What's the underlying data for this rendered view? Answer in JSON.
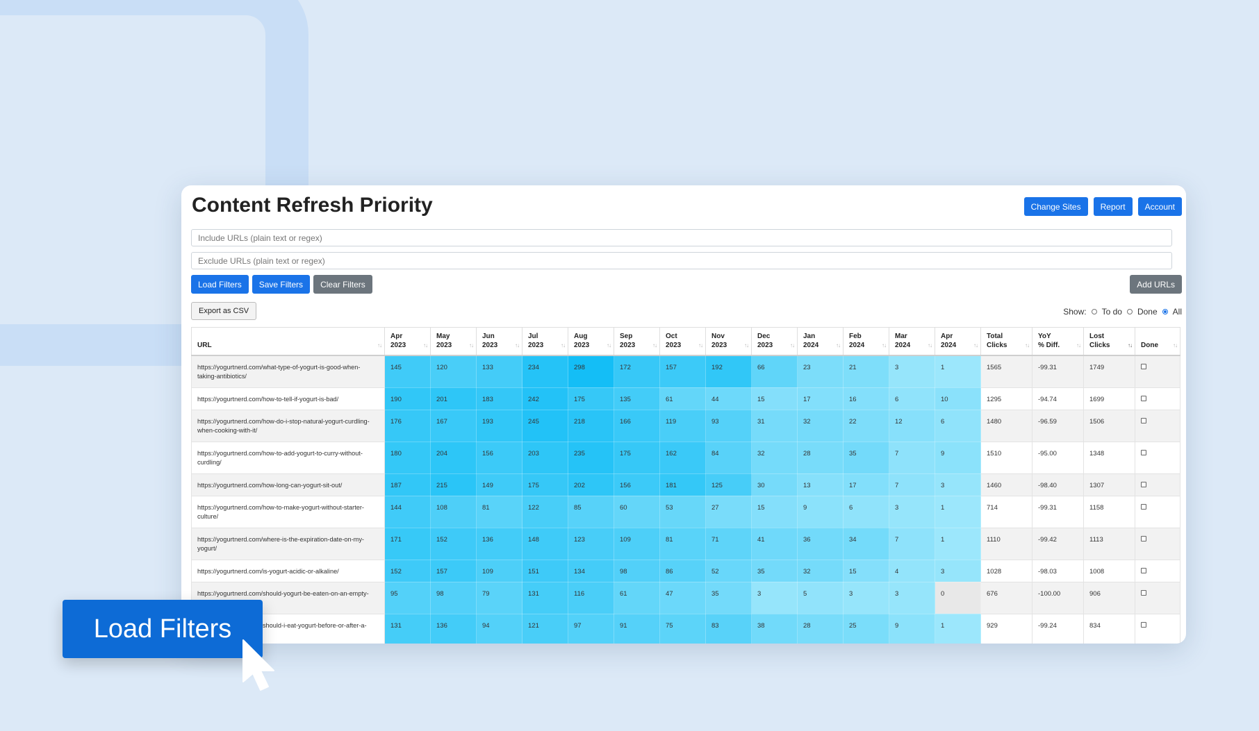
{
  "title": "Content Refresh Priority",
  "top_buttons": {
    "change_sites": "Change Sites",
    "report": "Report",
    "account": "Account"
  },
  "include_placeholder": "Include URLs (plain text or regex)",
  "exclude_placeholder": "Exclude URLs (plain text or regex)",
  "filter_buttons": {
    "load": "Load Filters",
    "save": "Save Filters",
    "clear": "Clear Filters"
  },
  "add_urls": "Add URLs",
  "export_csv": "Export as CSV",
  "show": {
    "label": "Show:",
    "todo": "To do",
    "done": "Done",
    "all": "All",
    "selected": "All"
  },
  "columns": [
    "URL",
    "Apr 2023",
    "May 2023",
    "Jun 2023",
    "Jul 2023",
    "Aug 2023",
    "Sep 2023",
    "Oct 2023",
    "Nov 2023",
    "Dec 2023",
    "Jan 2024",
    "Feb 2024",
    "Mar 2024",
    "Apr 2024",
    "Total Clicks",
    "YoY % Diff.",
    "Lost Clicks",
    "Done"
  ],
  "rows": [
    {
      "url": "https://yogurtnerd.com/what-type-of-yogurt-is-good-when-taking-antibiotics/",
      "months": [
        145,
        120,
        133,
        234,
        298,
        172,
        157,
        192,
        66,
        23,
        21,
        3,
        1
      ],
      "total": "1565",
      "yoy": "-99.31",
      "lost": "1749"
    },
    {
      "url": "https://yogurtnerd.com/how-to-tell-if-yogurt-is-bad/",
      "months": [
        190,
        201,
        183,
        242,
        175,
        135,
        61,
        44,
        15,
        17,
        16,
        6,
        10
      ],
      "total": "1295",
      "yoy": "-94.74",
      "lost": "1699"
    },
    {
      "url": "https://yogurtnerd.com/how-do-i-stop-natural-yogurt-curdling-when-cooking-with-it/",
      "months": [
        176,
        167,
        193,
        245,
        218,
        166,
        119,
        93,
        31,
        32,
        22,
        12,
        6
      ],
      "total": "1480",
      "yoy": "-96.59",
      "lost": "1506"
    },
    {
      "url": "https://yogurtnerd.com/how-to-add-yogurt-to-curry-without-curdling/",
      "months": [
        180,
        204,
        156,
        203,
        235,
        175,
        162,
        84,
        32,
        28,
        35,
        7,
        9
      ],
      "total": "1510",
      "yoy": "-95.00",
      "lost": "1348"
    },
    {
      "url": "https://yogurtnerd.com/how-long-can-yogurt-sit-out/",
      "months": [
        187,
        215,
        149,
        175,
        202,
        156,
        181,
        125,
        30,
        13,
        17,
        7,
        3
      ],
      "total": "1460",
      "yoy": "-98.40",
      "lost": "1307"
    },
    {
      "url": "https://yogurtnerd.com/how-to-make-yogurt-without-starter-culture/",
      "months": [
        144,
        108,
        81,
        122,
        85,
        60,
        53,
        27,
        15,
        9,
        6,
        3,
        1
      ],
      "total": "714",
      "yoy": "-99.31",
      "lost": "1158"
    },
    {
      "url": "https://yogurtnerd.com/where-is-the-expiration-date-on-my-yogurt/",
      "months": [
        171,
        152,
        136,
        148,
        123,
        109,
        81,
        71,
        41,
        36,
        34,
        7,
        1
      ],
      "total": "1110",
      "yoy": "-99.42",
      "lost": "1113"
    },
    {
      "url": "https://yogurtnerd.com/is-yogurt-acidic-or-alkaline/",
      "months": [
        152,
        157,
        109,
        151,
        134,
        98,
        86,
        52,
        35,
        32,
        15,
        4,
        3
      ],
      "total": "1028",
      "yoy": "-98.03",
      "lost": "1008"
    },
    {
      "url": "https://yogurtnerd.com/should-yogurt-be-eaten-on-an-empty-stomach/",
      "months": [
        95,
        98,
        79,
        131,
        116,
        61,
        47,
        35,
        3,
        5,
        3,
        3,
        0
      ],
      "total": "676",
      "yoy": "-100.00",
      "lost": "906"
    },
    {
      "url": "https://yogurtnerd.com/should-i-eat-yogurt-before-or-after-a-workout/",
      "months": [
        131,
        136,
        94,
        121,
        97,
        91,
        75,
        83,
        38,
        28,
        25,
        9,
        1
      ],
      "total": "929",
      "yoy": "-99.24",
      "lost": "834"
    }
  ],
  "callout": "Load Filters"
}
